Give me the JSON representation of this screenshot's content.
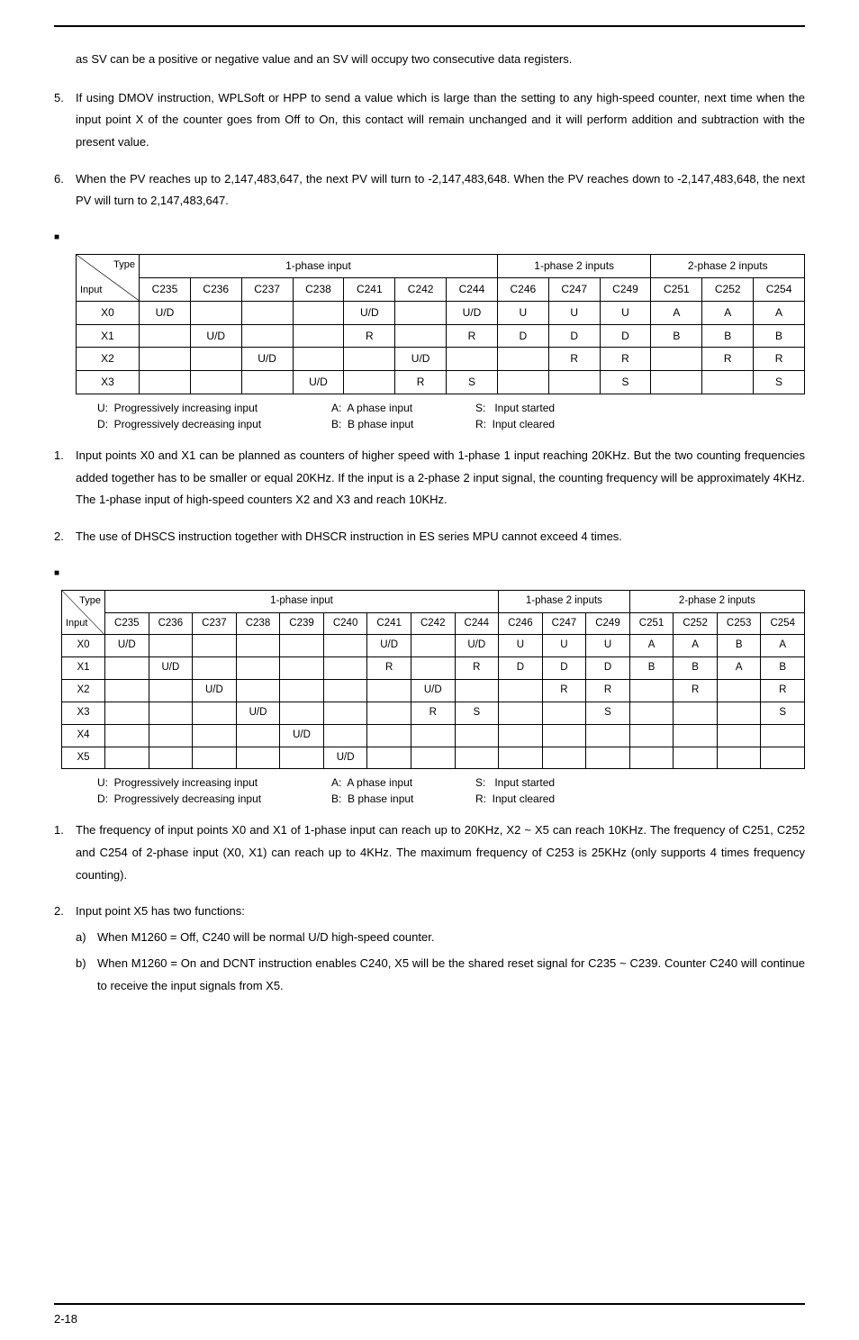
{
  "intro": "as SV can be a positive or negative value and an SV will occupy two consecutive data registers.",
  "p5": "If using DMOV instruction, WPLSoft or HPP to send a value which is large than the setting to any high-speed counter, next time when the input point X of the counter goes from Off to On, this contact will remain unchanged and it will perform addition and subtraction with the present value.",
  "p6": "When the PV reaches up to 2,147,483,647, the next PV will turn to -2,147,483,648. When the PV reaches down to -2,147,483,648, the next PV will turn to 2,147,483,647.",
  "table1": {
    "diag_top": "Type",
    "diag_bot": "Input",
    "groups": [
      "1-phase input",
      "1-phase 2 inputs",
      "2-phase 2 inputs"
    ],
    "cols": [
      "C235",
      "C236",
      "C237",
      "C238",
      "C241",
      "C242",
      "C244",
      "C246",
      "C247",
      "C249",
      "C251",
      "C252",
      "C254"
    ],
    "rows": [
      {
        "h": "X0",
        "c": [
          "U/D",
          "",
          "",
          "",
          "U/D",
          "",
          "U/D",
          "U",
          "U",
          "U",
          "A",
          "A",
          "A"
        ]
      },
      {
        "h": "X1",
        "c": [
          "",
          "U/D",
          "",
          "",
          "R",
          "",
          "R",
          "D",
          "D",
          "D",
          "B",
          "B",
          "B"
        ]
      },
      {
        "h": "X2",
        "c": [
          "",
          "",
          "U/D",
          "",
          "",
          "U/D",
          "",
          "",
          "R",
          "R",
          "",
          "R",
          "R"
        ]
      },
      {
        "h": "X3",
        "c": [
          "",
          "",
          "",
          "U/D",
          "",
          "R",
          "S",
          "",
          "",
          "S",
          "",
          "",
          "S"
        ]
      }
    ]
  },
  "legend": {
    "u": "U:  Progressively increasing input",
    "d": "D:  Progressively decreasing input",
    "a": "A:  A phase input",
    "b": "B:  B phase input",
    "s": "S:   Input started",
    "r": "R:  Input cleared"
  },
  "s1p1": "Input points X0 and X1 can be planned as counters of higher speed with 1-phase 1 input reaching 20KHz. But the two counting frequencies added together has to be smaller or equal 20KHz. If the input is a 2-phase 2 input signal, the counting frequency will be approximately 4KHz. The 1-phase input of high-speed counters X2 and X3 and reach 10KHz.",
  "s1p2": "The use of DHSCS instruction together with DHSCR instruction in ES series MPU cannot exceed 4 times.",
  "table2": {
    "diag_top": "Type",
    "diag_bot": "Input",
    "groups": [
      "1-phase input",
      "1-phase 2 inputs",
      "2-phase 2 inputs"
    ],
    "cols": [
      "C235",
      "C236",
      "C237",
      "C238",
      "C239",
      "C240",
      "C241",
      "C242",
      "C244",
      "C246",
      "C247",
      "C249",
      "C251",
      "C252",
      "C253",
      "C254"
    ],
    "rows": [
      {
        "h": "X0",
        "c": [
          "U/D",
          "",
          "",
          "",
          "",
          "",
          "U/D",
          "",
          "U/D",
          "U",
          "U",
          "U",
          "A",
          "A",
          "B",
          "A"
        ]
      },
      {
        "h": "X1",
        "c": [
          "",
          "U/D",
          "",
          "",
          "",
          "",
          "R",
          "",
          "R",
          "D",
          "D",
          "D",
          "B",
          "B",
          "A",
          "B"
        ]
      },
      {
        "h": "X2",
        "c": [
          "",
          "",
          "U/D",
          "",
          "",
          "",
          "",
          "U/D",
          "",
          "",
          "R",
          "R",
          "",
          "R",
          "",
          "R"
        ]
      },
      {
        "h": "X3",
        "c": [
          "",
          "",
          "",
          "U/D",
          "",
          "",
          "",
          "R",
          "S",
          "",
          "",
          "S",
          "",
          "",
          "",
          "S"
        ]
      },
      {
        "h": "X4",
        "c": [
          "",
          "",
          "",
          "",
          "U/D",
          "",
          "",
          "",
          "",
          "",
          "",
          "",
          "",
          "",
          "",
          ""
        ]
      },
      {
        "h": "X5",
        "c": [
          "",
          "",
          "",
          "",
          "",
          "U/D",
          "",
          "",
          "",
          "",
          "",
          "",
          "",
          "",
          "",
          ""
        ]
      }
    ]
  },
  "s2p1": "The frequency of input points X0 and X1 of 1-phase input can reach up to 20KHz, X2 ~ X5 can reach 10KHz. The frequency of C251, C252 and C254 of 2-phase input (X0, X1) can reach up to 4KHz. The maximum frequency of C253 is 25KHz (only supports 4 times frequency counting).",
  "s2p2": "Input point X5 has two functions:",
  "s2a": "When M1260 = Off, C240 will be normal U/D high-speed counter.",
  "s2b": "When M1260 = On and DCNT instruction enables C240, X5 will be the shared reset signal for C235 ~ C239. Counter C240 will continue to receive the input signals from X5.",
  "page": "2-18",
  "nums": {
    "n5": "5.",
    "n6": "6.",
    "n1": "1.",
    "n2": "2.",
    "a": "a)",
    "b": "b)"
  }
}
